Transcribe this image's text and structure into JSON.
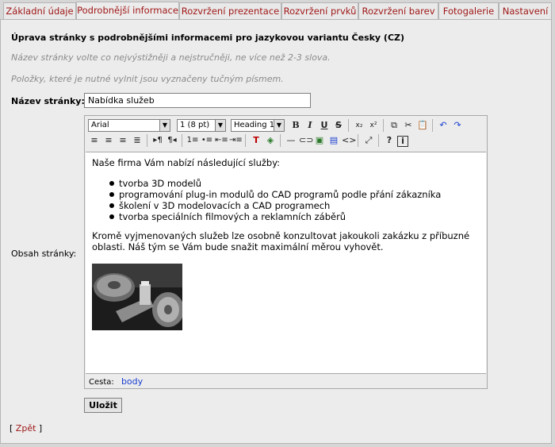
{
  "tabs": [
    {
      "label": "Základní údaje"
    },
    {
      "label": "Podrobnější informace"
    },
    {
      "label": "Rozvržení prezentace"
    },
    {
      "label": "Rozvržení prvků"
    },
    {
      "label": "Rozvržení barev"
    },
    {
      "label": "Fotogalerie"
    },
    {
      "label": "Nastavení"
    }
  ],
  "active_tab": "Podrobnější informace",
  "page": {
    "heading": "Úprava stránky s podrobnějšími informacemi pro jazykovou variantu Česky (CZ)",
    "hint_title": "Název stránky volte co nejvýstižněji a nejstručněji, ne více než 2-3 slova.",
    "hint_required": "Položky, které je nutné vylnit jsou vyznačeny tučným písmem."
  },
  "form": {
    "title_label": "Název stránky:",
    "title_value": "Nabídka služeb",
    "content_label": "Obsah stránky:",
    "save_label": "Uložit",
    "back_label": "Zpět"
  },
  "toolbar": {
    "font": "Arial",
    "size": "1 (8 pt)",
    "format": "Heading 1",
    "icons": [
      "bold-icon",
      "italic-icon",
      "underline-icon",
      "strikethrough-icon",
      "subscript-icon",
      "superscript-icon",
      "copy-icon",
      "cut-icon",
      "paste-icon",
      "undo-icon",
      "redo-icon",
      "align-left-icon",
      "align-center-icon",
      "align-right-icon",
      "align-justify-icon",
      "ltr-icon",
      "rtl-icon",
      "ordered-list-icon",
      "unordered-list-icon",
      "outdent-icon",
      "indent-icon",
      "text-color-icon",
      "background-color-icon",
      "horizontal-rule-icon",
      "link-icon",
      "image-icon",
      "table-icon",
      "source-code-icon",
      "fullscreen-icon",
      "help-icon",
      "about-icon"
    ]
  },
  "editor": {
    "intro": "Naše firma Vám nabízí následující služby:",
    "items": [
      "tvorba 3D modelů",
      "programování plug-in modulů do CAD programů podle přání zákazníka",
      "školení v 3D modelovacích a CAD programech",
      "tvorba speciálních filmových a reklamních záběrů"
    ],
    "outro": "Kromě vyjmenovaných služeb lze osobně konzultovat jakoukoli zakázku z příbuzné oblasti. Náš tým se Vám bude snažit maximální měrou vyhovět.",
    "path_label": "Cesta:",
    "path_value": "body"
  }
}
